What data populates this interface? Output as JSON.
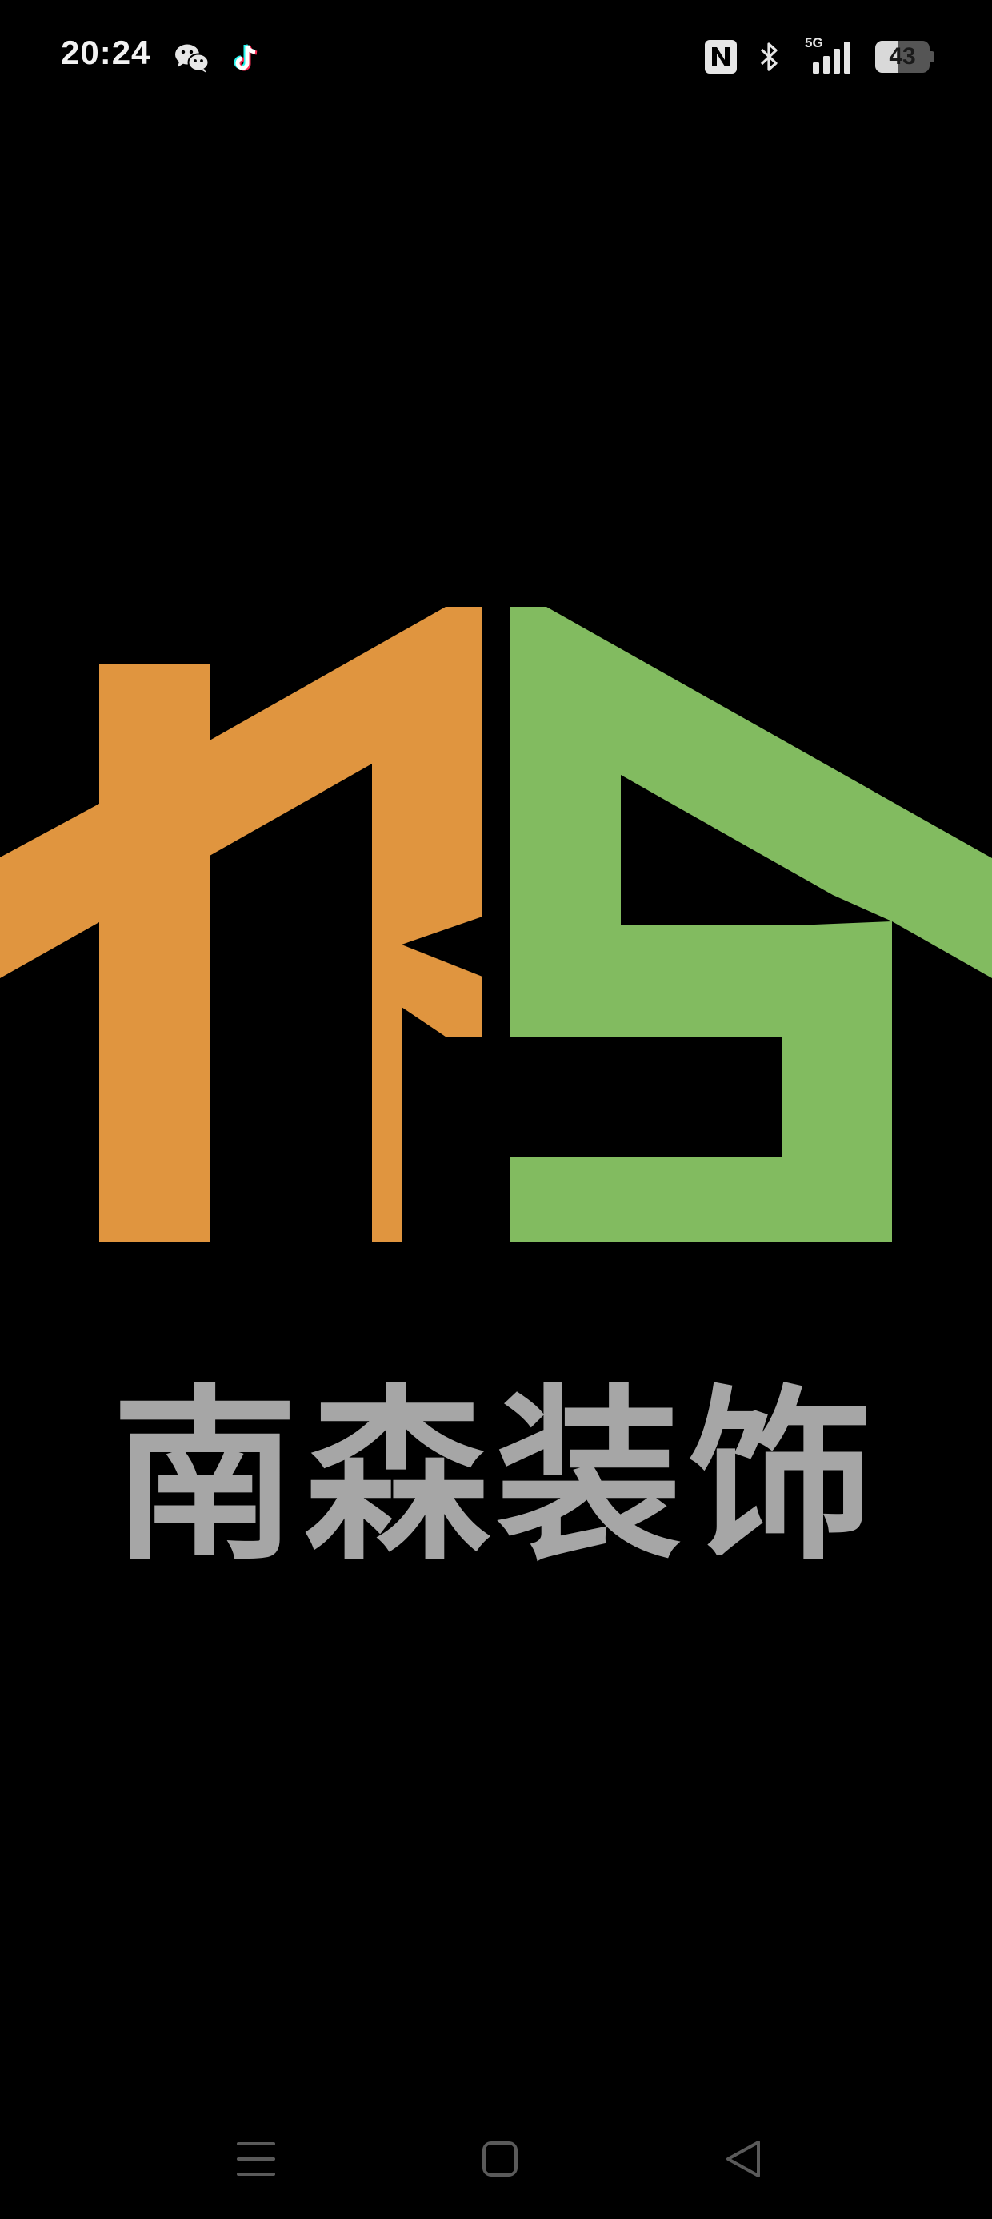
{
  "status_bar": {
    "time": "20:24",
    "left_icons": [
      "wechat-icon",
      "tiktok-icon"
    ],
    "right_icons": [
      "nfc-icon",
      "bluetooth-icon",
      "signal-5g-icon",
      "battery-icon"
    ],
    "network_label": "5G",
    "battery_level": "43",
    "battery_percent": 43
  },
  "logo": {
    "colors": {
      "orange": "#e0953f",
      "green": "#82bb60",
      "gray": "#a6a6a6",
      "background": "#000000"
    },
    "brand_name": "南森装饰"
  },
  "nav_bar": {
    "buttons": [
      "menu-icon",
      "home-icon",
      "back-icon"
    ],
    "color": "#5a5a5a"
  }
}
